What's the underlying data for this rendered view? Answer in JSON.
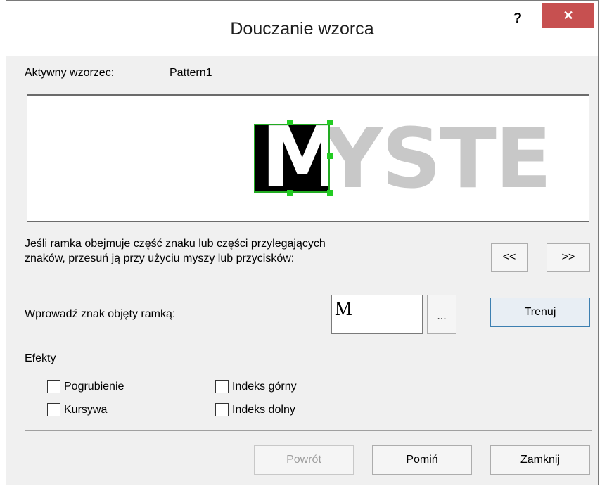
{
  "window": {
    "title": "Douczanie wzorca",
    "help_label": "?",
    "close_label": "✕"
  },
  "active_pattern": {
    "label": "Aktywny wzorzec:",
    "value": "Pattern1"
  },
  "preview": {
    "selected_char": "M",
    "remaining_text": "YSTE"
  },
  "instruction": {
    "line1": "Jeśli ramka obejmuje część znaku lub części przylegających",
    "line2": "znaków, przesuń ją przy użyciu myszy lub przycisków:"
  },
  "nav": {
    "prev_label": "<<",
    "next_label": ">>"
  },
  "char_entry": {
    "label": "Wprowadź znak objęty ramką:",
    "value": "M",
    "browse_label": "...",
    "train_label": "Trenuj"
  },
  "effects": {
    "heading": "Efekty",
    "bold": "Pogrubienie",
    "italic": "Kursywa",
    "superscript": "Indeks górny",
    "subscript": "Indeks dolny"
  },
  "footer": {
    "back_label": "Powrót",
    "skip_label": "Pomiń",
    "close_label": "Zamknij"
  }
}
